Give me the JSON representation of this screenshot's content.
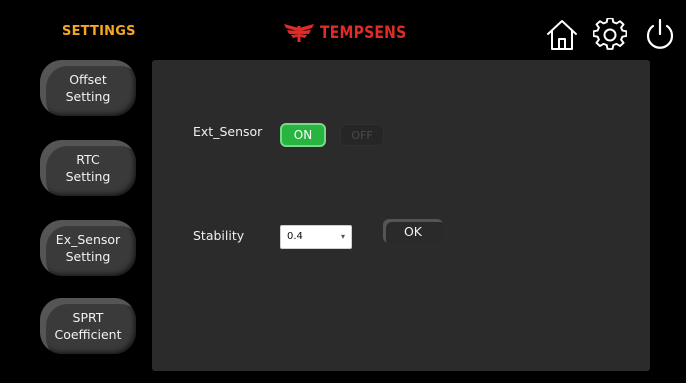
{
  "header": {
    "screen_title": "SETTINGS",
    "brand_name": "TEMPSENS",
    "icons": [
      "home-icon",
      "gear-icon",
      "power-icon"
    ]
  },
  "sidebar": {
    "items": [
      {
        "label": "Offset\nSetting"
      },
      {
        "label": "RTC\nSetting"
      },
      {
        "label": "Ex_Sensor\nSetting"
      },
      {
        "label": "SPRT\nCoefficient"
      }
    ]
  },
  "panel": {
    "ext_sensor_label": "Ext_Sensor",
    "on_label": "ON",
    "off_label": "OFF",
    "stability_label": "Stability",
    "stability_value": "0.4",
    "ok_label": "OK"
  },
  "colors": {
    "title_accent": "#f5a623",
    "brand": "#e02b27",
    "on_active": "#27b43f",
    "panel_bg": "#2b2b2b",
    "button_bg": "#3a3a3a"
  }
}
